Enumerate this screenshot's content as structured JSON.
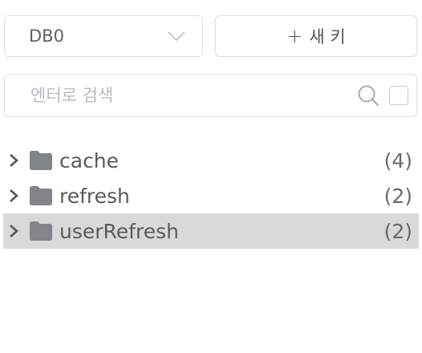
{
  "toolbar": {
    "db_selected": "DB0",
    "new_key_plus": "+",
    "new_key_label": "새 키"
  },
  "search": {
    "placeholder": "엔터로 검색",
    "value": ""
  },
  "tree": {
    "items": [
      {
        "label": "cache",
        "count": "(4)"
      },
      {
        "label": "refresh",
        "count": "(2)"
      },
      {
        "label": "userRefresh",
        "count": "(2)"
      }
    ]
  }
}
